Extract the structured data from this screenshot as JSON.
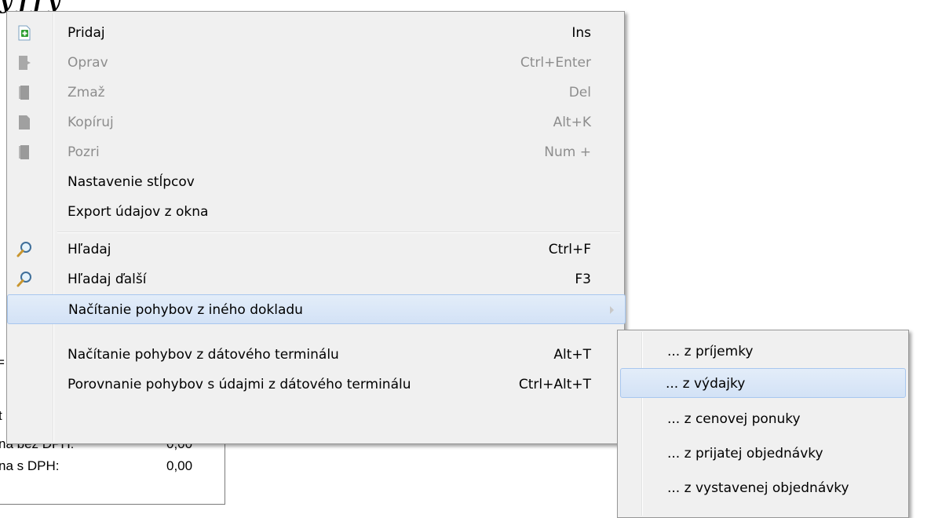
{
  "background": {
    "title_fragment": "ý j   j y",
    "summary": [
      {
        "label": "na bez DPH:",
        "value": "0,00"
      },
      {
        "label": "na s DPH:",
        "value": "0,00"
      }
    ],
    "left_fragments": [
      "=",
      "t"
    ]
  },
  "context_menu": {
    "items": [
      {
        "label": "Pridaj",
        "shortcut": "Ins",
        "icon": "add-document-icon",
        "enabled": true
      },
      {
        "label": "Oprav",
        "shortcut": "Ctrl+Enter",
        "icon": "edit-document-icon",
        "enabled": false
      },
      {
        "label": "Zmaž",
        "shortcut": "Del",
        "icon": "delete-document-icon",
        "enabled": false
      },
      {
        "label": "Kopíruj",
        "shortcut": "Alt+K",
        "icon": "copy-document-icon",
        "enabled": false
      },
      {
        "label": "Pozri",
        "shortcut": "Num +",
        "icon": "view-document-icon",
        "enabled": false
      },
      {
        "label": "Nastavenie stĺpcov",
        "shortcut": "",
        "icon": "",
        "enabled": true
      },
      {
        "label": "Export údajov z okna",
        "shortcut": "",
        "icon": "",
        "enabled": true
      },
      {
        "label": "Hľadaj",
        "shortcut": "Ctrl+F",
        "icon": "search-icon",
        "enabled": true
      },
      {
        "label": "Hľadaj ďalší",
        "shortcut": "F3",
        "icon": "search-icon",
        "enabled": true
      },
      {
        "label": "Načítanie pohybov z iného dokladu",
        "shortcut": "",
        "icon": "",
        "enabled": true,
        "submenu": true,
        "highlighted": true
      },
      {
        "label": "Načítanie pohybov z dátového terminálu",
        "shortcut": "Alt+T",
        "icon": "",
        "enabled": true
      },
      {
        "label": "Porovnanie pohybov s údajmi z dátového terminálu",
        "shortcut": "Ctrl+Alt+T",
        "icon": "",
        "enabled": true
      }
    ]
  },
  "submenu": {
    "items": [
      {
        "label": "... z príjemky",
        "highlighted": false
      },
      {
        "label": "... z výdajky",
        "highlighted": true
      },
      {
        "label": "... z cenovej ponuky",
        "highlighted": false
      },
      {
        "label": "... z prijatej objednávky",
        "highlighted": false
      },
      {
        "label": "... z vystavenej objednávky",
        "highlighted": false
      }
    ]
  },
  "colors": {
    "menu_bg": "#f0f0f0",
    "highlight_bg": "#d9e6f7",
    "highlight_border": "#a8c7ef",
    "disabled_text": "#8d8d8d",
    "add_icon_green": "#2e9e32"
  }
}
